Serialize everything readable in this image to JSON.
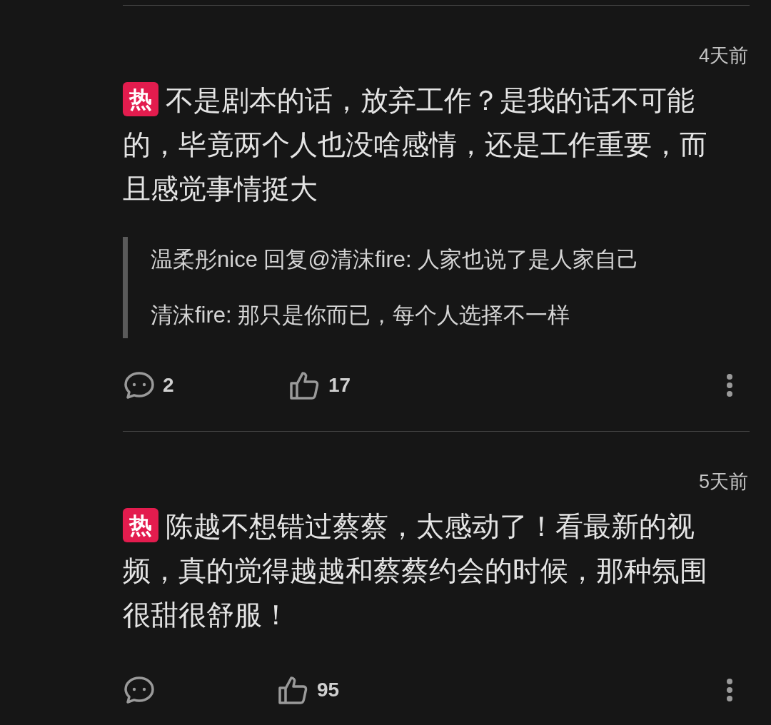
{
  "comments": [
    {
      "time": "4天前",
      "hot_badge": "热",
      "text": "不是剧本的话，放弃工作？是我的话不可能的，毕竟两个人也没啥感情，还是工作重要，而且感觉事情挺大",
      "replies": [
        "温柔彤nice 回复@清沫fire: 人家也说了是人家自己",
        "清沫fire: 那只是你而已，每个人选择不一样"
      ],
      "reply_count": "2",
      "likes": "17"
    },
    {
      "time": "5天前",
      "hot_badge": "热",
      "text": "陈越不想错过蔡蔡，太感动了！看最新的视频，真的觉得越越和蔡蔡约会的时候，那种氛围很甜很舒服！",
      "likes": "95"
    }
  ]
}
